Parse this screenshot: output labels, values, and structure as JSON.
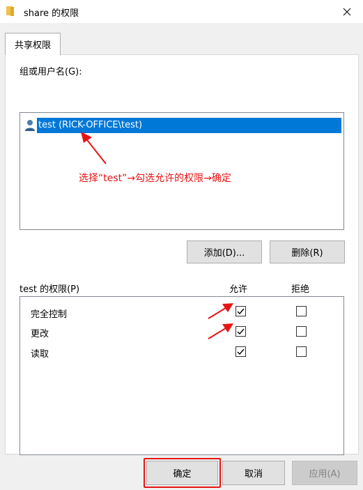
{
  "window": {
    "title": "share 的权限"
  },
  "tab": {
    "label": "共享权限"
  },
  "groups": {
    "label": "组或用户名(G):",
    "users": [
      "test (RICK-OFFICE\\test)"
    ]
  },
  "annotation": {
    "text": "选择“test”→勾选允许的权限→确定",
    "color": "#e81313"
  },
  "buttons": {
    "add": "添加(D)...",
    "remove": "删除(R)"
  },
  "permissions": {
    "label": "test 的权限(P)",
    "allow_header": "允许",
    "deny_header": "拒绝",
    "rows": [
      {
        "name": "完全控制",
        "allow": true,
        "deny": false
      },
      {
        "name": "更改",
        "allow": true,
        "deny": false
      },
      {
        "name": "读取",
        "allow": true,
        "deny": false
      }
    ]
  },
  "footer": {
    "ok": "确定",
    "cancel": "取消",
    "apply": "应用(A)",
    "apply_enabled": false
  },
  "colors": {
    "selection": "#0078d7",
    "annotation": "#e81313"
  }
}
